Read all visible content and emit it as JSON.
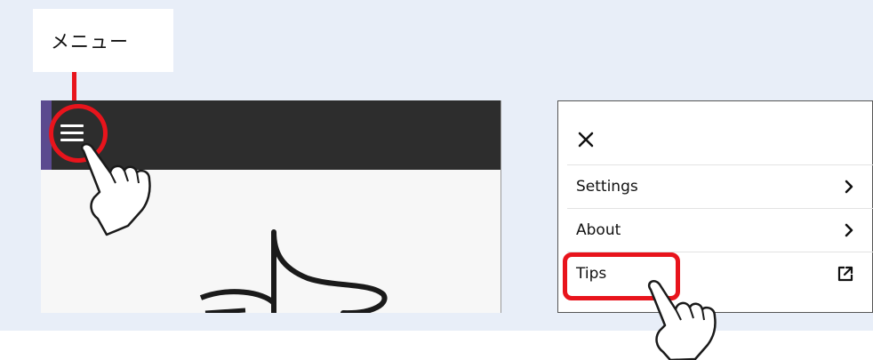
{
  "callout": {
    "label": "メニュー"
  },
  "app": {
    "menu_icon": "hamburger-menu-icon",
    "logo_icon": "app-logo-icon"
  },
  "menu": {
    "close_icon": "close-icon",
    "items": [
      {
        "label": "Settings",
        "icon": "chevron-right-icon"
      },
      {
        "label": "About",
        "icon": "chevron-right-icon"
      },
      {
        "label": "Tips",
        "icon": "external-link-icon"
      }
    ]
  },
  "colors": {
    "highlight": "#e8141c",
    "topbar": "#2d2d2d",
    "accent": "#5b4a8f",
    "panel_bg": "#e8eef8"
  }
}
